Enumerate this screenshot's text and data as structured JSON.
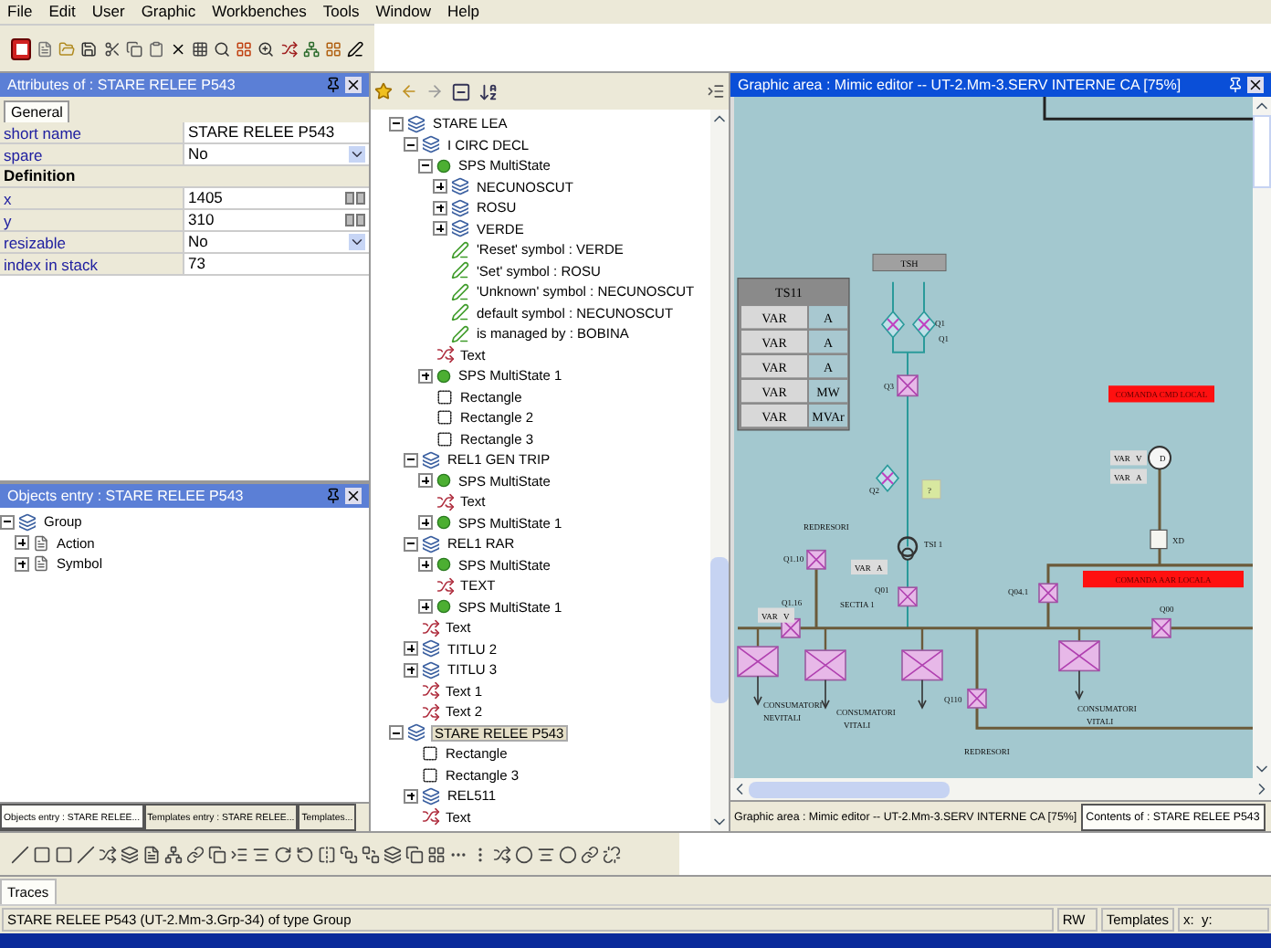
{
  "menu": [
    "File",
    "Edit",
    "User",
    "Graphic",
    "Workbenches",
    "Tools",
    "Window",
    "Help"
  ],
  "attributes": {
    "title": "Attributes of : STARE RELEE P543",
    "tabs": [
      {
        "label": "General",
        "selected": true
      }
    ],
    "rows": [
      {
        "kind": "text",
        "label": "short name",
        "value": "STARE RELEE P543"
      },
      {
        "kind": "select",
        "label": "spare",
        "value": "No"
      },
      {
        "kind": "section",
        "label": "Definition"
      },
      {
        "kind": "spin",
        "label": "x",
        "value": "1405"
      },
      {
        "kind": "spin",
        "label": "y",
        "value": "310"
      },
      {
        "kind": "select",
        "label": "resizable",
        "value": "No"
      },
      {
        "kind": "text",
        "label": "index in stack",
        "value": "73"
      }
    ]
  },
  "objects_entry": {
    "title": "Objects entry : STARE RELEE P543",
    "tree": [
      {
        "label": "Group",
        "kind": "group",
        "expanded": true,
        "children": [
          {
            "label": "Action",
            "kind": "item",
            "expanded": false
          },
          {
            "label": "Symbol",
            "kind": "item",
            "expanded": false
          }
        ]
      }
    ],
    "tabs": [
      {
        "label": "Objects entry : STARE RELEE...",
        "selected": true
      },
      {
        "label": "Templates entry : STARE RELEE...",
        "selected": false
      },
      {
        "label": "Templates...",
        "selected": false
      }
    ]
  },
  "tree": [
    {
      "label": "STARE LEA",
      "kind": "group",
      "expanded": true,
      "selected": false,
      "children": [
        {
          "label": "I CIRC DECL",
          "kind": "group",
          "expanded": true,
          "selected": false,
          "children": [
            {
              "label": "SPS MultiState",
              "kind": "state",
              "expanded": true,
              "selected": false,
              "children": [
                {
                  "label": "NECUNOSCUT",
                  "kind": "group",
                  "expanded": false,
                  "selected": false
                },
                {
                  "label": "ROSU",
                  "kind": "group",
                  "expanded": false,
                  "selected": false
                },
                {
                  "label": "VERDE",
                  "kind": "group",
                  "expanded": false,
                  "selected": false
                },
                {
                  "label": "'Reset' symbol : VERDE",
                  "kind": "symbol",
                  "selected": false
                },
                {
                  "label": "'Set' symbol : ROSU",
                  "kind": "symbol",
                  "selected": false
                },
                {
                  "label": "'Unknown' symbol : NECUNOSCUT",
                  "kind": "symbol",
                  "selected": false
                },
                {
                  "label": "default symbol : NECUNOSCUT",
                  "kind": "symbol",
                  "selected": false
                },
                {
                  "label": "is managed by : BOBINA",
                  "kind": "symbol",
                  "selected": false
                }
              ]
            },
            {
              "label": "Text",
              "kind": "text",
              "selected": false
            },
            {
              "label": "SPS MultiState 1",
              "kind": "state",
              "expanded": false,
              "selected": false
            },
            {
              "label": "Rectangle",
              "kind": "rect",
              "selected": false
            },
            {
              "label": "Rectangle 2",
              "kind": "rect",
              "selected": false
            },
            {
              "label": "Rectangle 3",
              "kind": "rect",
              "selected": false
            }
          ]
        },
        {
          "label": "REL1 GEN TRIP",
          "kind": "group",
          "expanded": true,
          "selected": false,
          "children": [
            {
              "label": "SPS MultiState",
              "kind": "state",
              "expanded": false,
              "selected": false
            },
            {
              "label": "Text",
              "kind": "text",
              "selected": false
            },
            {
              "label": "SPS MultiState 1",
              "kind": "state",
              "expanded": false,
              "selected": false
            }
          ]
        },
        {
          "label": "REL1 RAR",
          "kind": "group",
          "expanded": true,
          "selected": false,
          "children": [
            {
              "label": "SPS MultiState",
              "kind": "state",
              "expanded": false,
              "selected": false
            },
            {
              "label": "TEXT",
              "kind": "text",
              "selected": false
            },
            {
              "label": "SPS MultiState 1",
              "kind": "state",
              "expanded": false,
              "selected": false
            }
          ]
        },
        {
          "label": "Text",
          "kind": "text",
          "selected": false
        },
        {
          "label": "TITLU 2",
          "kind": "group",
          "expanded": false,
          "selected": false
        },
        {
          "label": "TITLU 3",
          "kind": "group",
          "expanded": false,
          "selected": false
        },
        {
          "label": "Text 1",
          "kind": "text",
          "selected": false
        },
        {
          "label": "Text 2",
          "kind": "text",
          "selected": false
        }
      ]
    },
    {
      "label": "STARE RELEE P543",
      "kind": "group",
      "expanded": true,
      "selected": true,
      "children": [
        {
          "label": "Rectangle",
          "kind": "rect",
          "selected": false
        },
        {
          "label": "Rectangle 3",
          "kind": "rect",
          "selected": false
        },
        {
          "label": "REL511",
          "kind": "group",
          "expanded": false,
          "selected": false
        },
        {
          "label": "Text",
          "kind": "text",
          "selected": false
        }
      ]
    }
  ],
  "graphic": {
    "title": "Graphic area : Mimic editor -- UT-2.Mm-3.SERV INTERNE CA   [75%]",
    "table": {
      "title": "TS11",
      "rows": [
        [
          "VAR",
          "A"
        ],
        [
          "VAR",
          "A"
        ],
        [
          "VAR",
          "A"
        ],
        [
          "VAR",
          "MW"
        ],
        [
          "VAR",
          "MVAr"
        ]
      ]
    },
    "tag": "TSH",
    "alarms": [
      "COMANDA CMD LOCAL",
      "COMANDA AAR LOCALA"
    ],
    "labels": [
      "Q1",
      "Q1",
      "Q3",
      "Q2",
      "?",
      "TSI 1",
      "Q01",
      "REDRESORI",
      "Q1.10",
      "Q1.16",
      "SECTIA 1",
      "Q04.1",
      "Q00",
      "XD",
      "D",
      "Q110",
      "CONSUMATORI",
      "NEVITALI",
      "CONSUMATORI",
      "VITALI",
      "CONSUMATORI",
      "VITALI",
      "REDRESORI"
    ],
    "readings": [
      [
        "VAR",
        "V"
      ],
      [
        "VAR",
        "A"
      ],
      [
        "VAR",
        "V"
      ],
      [
        "VAR",
        "A"
      ]
    ],
    "tabs": [
      {
        "label": "Graphic area : Mimic editor -- UT-2.Mm-3.SERV INTERNE CA   [75%]",
        "selected": true
      },
      {
        "label": "Contents of : STARE RELEE P543",
        "selected": false
      }
    ]
  },
  "traces": {
    "tab": "Traces"
  },
  "status_bar": {
    "message": "STARE RELEE P543 (UT-2.Mm-3.Grp-34) of type Group",
    "mode": "RW",
    "templates": "Templates",
    "coords": "x:  y:"
  }
}
